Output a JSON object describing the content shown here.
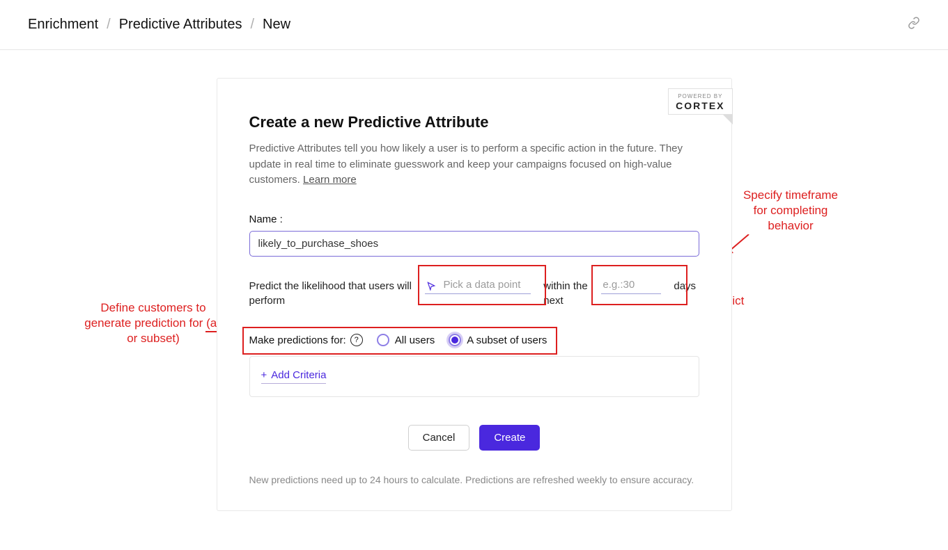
{
  "breadcrumb": {
    "a": "Enrichment",
    "b": "Predictive Attributes",
    "c": "New"
  },
  "cortex": {
    "powered": "POWERED BY",
    "name": "CORTEX"
  },
  "form": {
    "title": "Create a new Predictive Attribute",
    "desc": "Predictive Attributes tell you how likely a user is to perform a specific action in the future. They update in real time to eliminate guesswork and keep your campaigns focused on high-value customers. ",
    "learn_more": "Learn more",
    "name_label": "Name :",
    "name_value": "likely_to_purchase_shoes",
    "sentence1": "Predict the likelihood that users will perform",
    "pick_placeholder": "Pick a data point",
    "sentence2": "within the next",
    "time_placeholder": "e.g.:30",
    "sentence3": "days",
    "predict_for_label": "Make predictions for:",
    "radio_all": "All users",
    "radio_subset": "A subset of users",
    "add_criteria": "Add Criteria",
    "cancel": "Cancel",
    "create": "Create",
    "footer": "New predictions need up to 24 hours to calculate. Predictions are refreshed weekly to ensure accuracy."
  },
  "annotations": {
    "left": "Define customers to generate prediction for (all or subset)",
    "right": "Specify timeframe for completing behavior",
    "bottom": "Define customer behavior to predict"
  }
}
